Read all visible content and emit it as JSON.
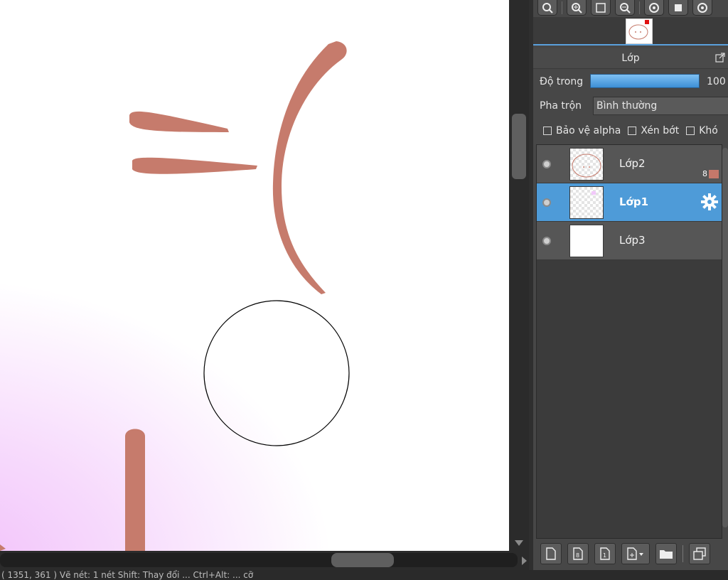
{
  "canvas": {
    "stroke_color": "#c67b6c",
    "cursor_shape": "circle-brush-cursor"
  },
  "toolbar": {
    "icons": [
      "zoom-reset-icon",
      "zoom-in-icon",
      "fit-screen-icon",
      "zoom-out-icon",
      "rotate-left-icon",
      "flip-icon",
      "rotate-right-icon"
    ]
  },
  "layer_panel": {
    "title": "Lớp",
    "opacity_label": "Độ trong",
    "opacity_value": "100",
    "opacity_fraction": 1.0,
    "blend_label": "Pha trộn",
    "blend_value": "Bình thường",
    "checkboxes": {
      "protect_alpha": "Bảo vệ alpha",
      "clipping": "Xén bớt",
      "lock": "Khó"
    },
    "layers": [
      {
        "name": "Lớp2",
        "selected": false,
        "badge": "8"
      },
      {
        "name": "Lớp1",
        "selected": true
      },
      {
        "name": "Lớp3",
        "selected": false
      }
    ]
  },
  "status": {
    "text": "( 1351, 361 )  Vẽ nét: 1 nét  Shift: Thay đổi ... Ctrl+Alt: ... cỡ"
  },
  "colors": {
    "accent": "#4e9bd8",
    "panel": "#474747",
    "stroke": "#c67b6c"
  }
}
